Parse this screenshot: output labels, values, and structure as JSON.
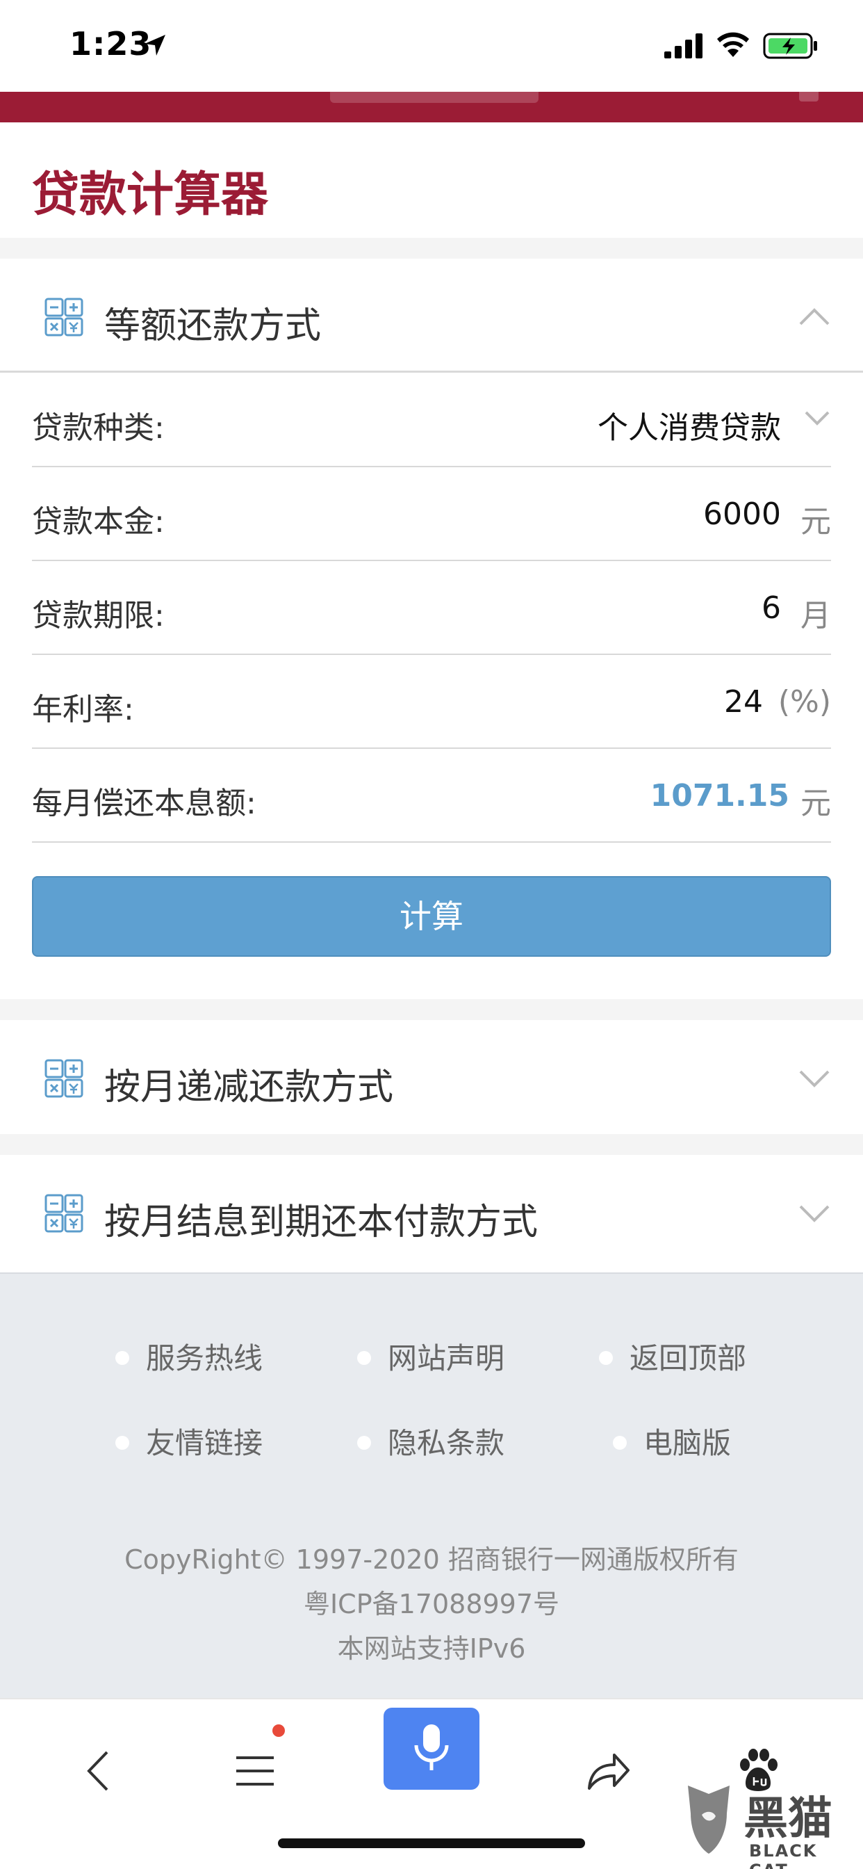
{
  "status_bar": {
    "time": "1:23"
  },
  "page": {
    "title": "贷款计算器"
  },
  "section_equal": {
    "title": "等额还款方式"
  },
  "form": {
    "rows": [
      {
        "label": "贷款种类:",
        "value": "个人消费贷款",
        "unit": ""
      },
      {
        "label": "贷款本金:",
        "value": "6000",
        "unit": "元"
      },
      {
        "label": "贷款期限:",
        "value": "6",
        "unit": "月"
      },
      {
        "label": "年利率:",
        "value": "24",
        "unit": "(%)"
      },
      {
        "label": "每月偿还本息额:",
        "value": "1071.15",
        "unit": "元"
      }
    ],
    "calculate_label": "计算"
  },
  "section_decreasing": {
    "title": "按月递减还款方式"
  },
  "section_interest": {
    "title": "按月结息到期还本付款方式"
  },
  "footer": {
    "links": [
      "服务热线",
      "网站声明",
      "返回顶部",
      "友情链接",
      "隐私条款",
      "电脑版"
    ],
    "copyright": "CopyRight© 1997-2020 招商银行一网通版权所有",
    "icp": "粤ICP备17088997号",
    "ipv6": "本网站支持IPv6"
  },
  "watermark": {
    "name": "黑猫",
    "sub": "BLACK CAT"
  },
  "colors": {
    "brand": "#9b1c35",
    "button": "#5ea0d1",
    "result": "#5b9ccb",
    "mic": "#4e84f1"
  },
  "icons": [
    "location-arrow-icon",
    "signal-icon",
    "wifi-icon",
    "battery-charging-icon",
    "calculator-icon",
    "chevron-up-icon",
    "chevron-down-icon",
    "back-icon",
    "menu-icon",
    "microphone-icon",
    "share-icon",
    "baidu-paw-icon"
  ]
}
